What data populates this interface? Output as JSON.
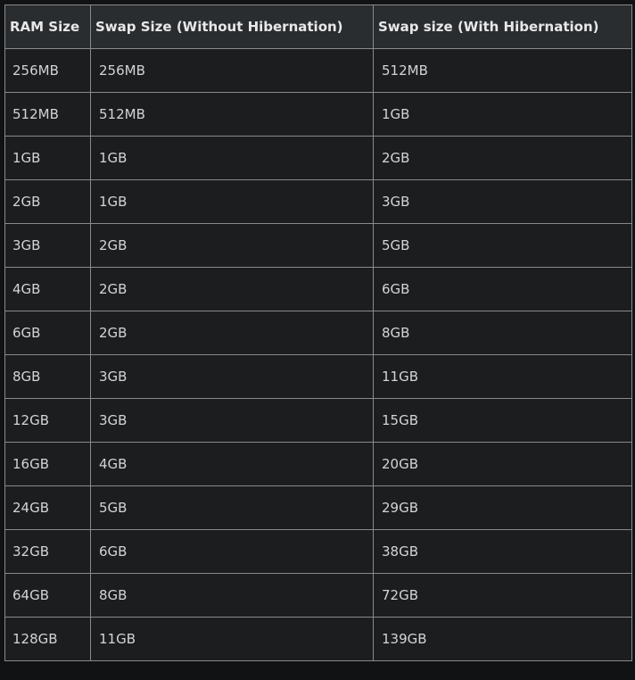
{
  "table": {
    "headers": [
      "RAM Size",
      "Swap Size (Without Hibernation)",
      "Swap size (With Hibernation)"
    ],
    "rows": [
      [
        "256MB",
        "256MB",
        "512MB"
      ],
      [
        "512MB",
        "512MB",
        "1GB"
      ],
      [
        "1GB",
        "1GB",
        "2GB"
      ],
      [
        "2GB",
        "1GB",
        "3GB"
      ],
      [
        "3GB",
        "2GB",
        "5GB"
      ],
      [
        "4GB",
        "2GB",
        "6GB"
      ],
      [
        "6GB",
        "2GB",
        "8GB"
      ],
      [
        "8GB",
        "3GB",
        "11GB"
      ],
      [
        "12GB",
        "3GB",
        "15GB"
      ],
      [
        "16GB",
        "4GB",
        "20GB"
      ],
      [
        "24GB",
        "5GB",
        "29GB"
      ],
      [
        "32GB",
        "6GB",
        "38GB"
      ],
      [
        "64GB",
        "8GB",
        "72GB"
      ],
      [
        "128GB",
        "11GB",
        "139GB"
      ]
    ]
  },
  "colors": {
    "page_background": "#111213",
    "header_background": "#2a2d30",
    "cell_background": "#1c1d1f",
    "border": "#8a8a8a",
    "text": "#d4d4d4"
  }
}
